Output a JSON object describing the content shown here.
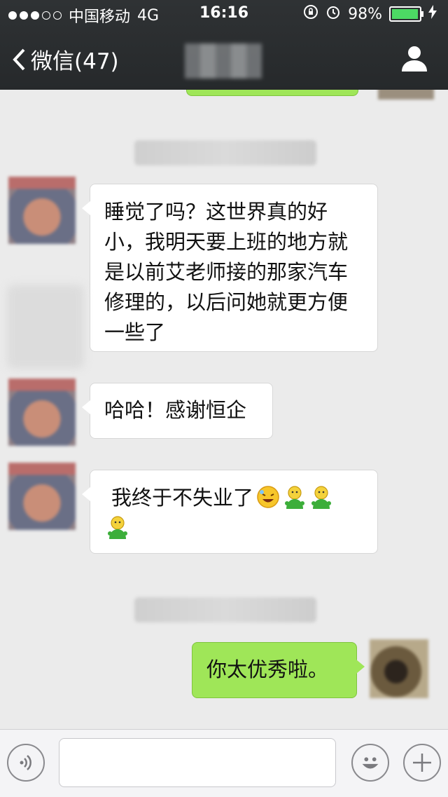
{
  "status_bar": {
    "carrier": "中国移动",
    "network": "4G",
    "time": "16:16",
    "battery": "98%",
    "battery_level": 0.98
  },
  "nav": {
    "back_label": "微信(47)"
  },
  "messages": [
    {
      "side": "in",
      "text": "睡觉了吗？这世界真的好小，我明天要上班的地方就是以前艾老师接的那家汽车修理的，以后问她就更方便一些了"
    },
    {
      "side": "in",
      "text": "哈哈！感谢恒企"
    },
    {
      "side": "in",
      "text": "我终于不失业了"
    },
    {
      "side": "out",
      "text": "你太优秀啦。"
    }
  ],
  "icons": {
    "back": "chevron-left-icon",
    "profile": "person-icon",
    "voice": "voice-icon",
    "emoji": "smiley-icon",
    "plus": "plus-icon"
  },
  "colors": {
    "outgoing_bubble": "#9fe658",
    "incoming_bubble": "#ffffff",
    "topbar": "#2b2e30"
  }
}
